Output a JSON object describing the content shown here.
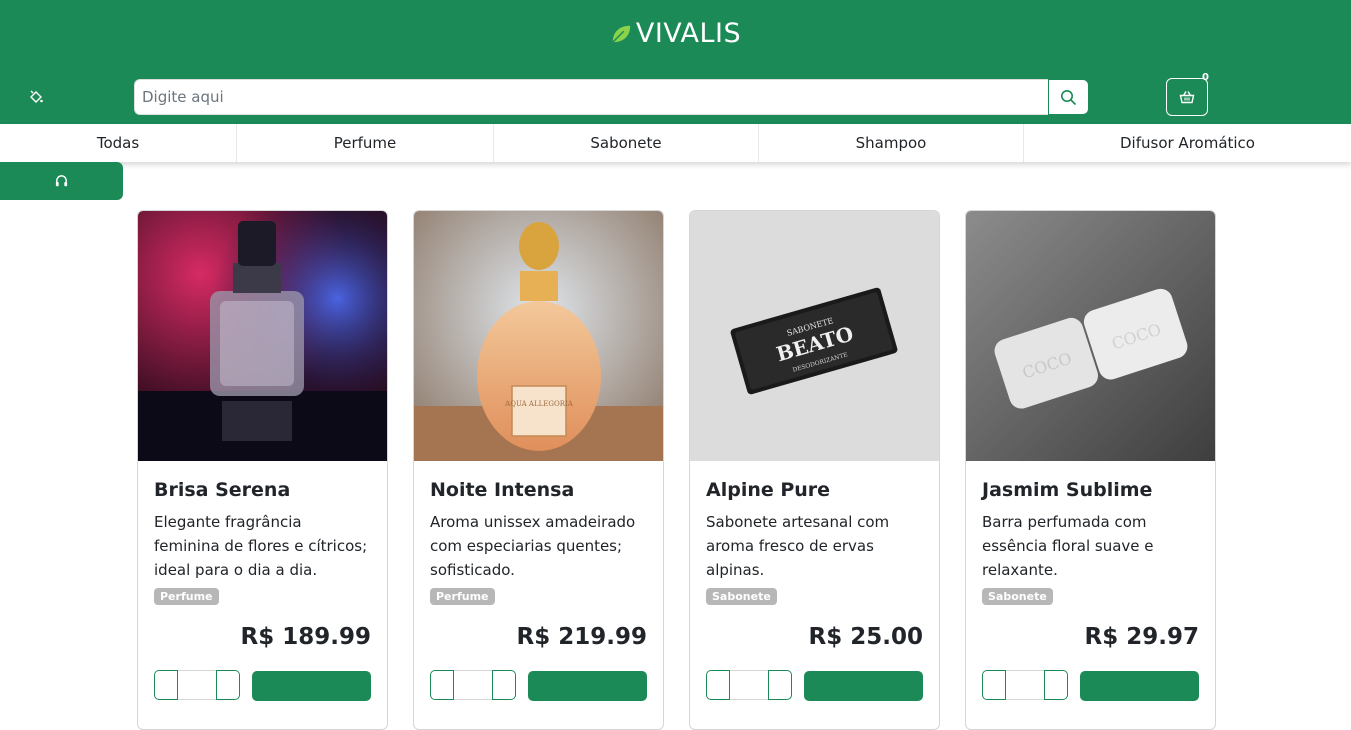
{
  "brand": {
    "name": "VIVALIS",
    "color": "#1b8a57"
  },
  "search": {
    "placeholder": "Digite aqui"
  },
  "cart": {
    "count": "0"
  },
  "categories": [
    {
      "label": "Todas"
    },
    {
      "label": "Perfume"
    },
    {
      "label": "Sabonete"
    },
    {
      "label": "Shampoo"
    },
    {
      "label": "Difusor Aromático"
    }
  ],
  "icons": {
    "theme": "paint-bucket-icon",
    "search": "search-icon",
    "cart": "basket-icon",
    "support": "headset-icon"
  },
  "products": [
    {
      "name": "Brisa Serena",
      "description": "Elegante fragrância feminina de flores e cítricos; ideal para o dia a dia.",
      "category": "Perfume",
      "price": "R$ 189.99"
    },
    {
      "name": "Noite Intensa",
      "description": "Aroma unissex amadeirado com especiarias quentes; sofisticado.",
      "category": "Perfume",
      "price": "R$ 219.99"
    },
    {
      "name": "Alpine Pure",
      "description": "Sabonete artesanal com aroma fresco de ervas alpinas.",
      "category": "Sabonete",
      "price": "R$ 25.00"
    },
    {
      "name": "Jasmim Sublime",
      "description": "Barra perfumada com essência floral suave e relaxante.",
      "category": "Sabonete",
      "price": "R$ 29.97"
    }
  ],
  "product_images": {
    "p1_label": "",
    "p2_label": "AQUA ALLEGORIA",
    "p3_label_top": "SABONETE",
    "p3_label_main": "BEATO",
    "p3_label_bottom": "DESODORIZANTE",
    "p4_label": "COCO"
  }
}
